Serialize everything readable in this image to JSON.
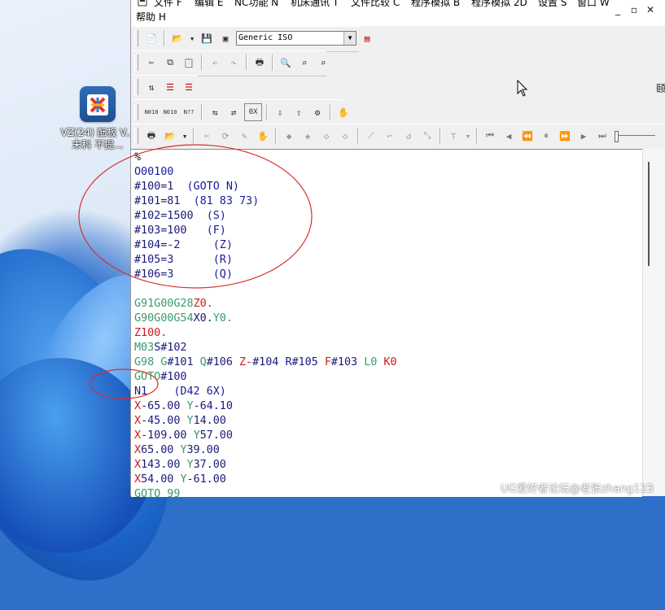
{
  "desktop": {
    "icon_label_line1": "VZ(24) 酝板 V...",
    "icon_label_line2": "末科 不提..."
  },
  "menubar": {
    "items": [
      "文件 F",
      "编辑 E",
      "NC功能 N",
      "机床通讯 T",
      "文件比较 C",
      "程序模拟 B",
      "程序模拟 2D",
      "设置 S",
      "窗口 W"
    ],
    "help": "帮助 H"
  },
  "toolbar": {
    "controller_select": "Generic ISO"
  },
  "side_glyph": "颐",
  "editor": {
    "lines": [
      [
        {
          "t": "%",
          "c": "c-dark"
        }
      ],
      [
        {
          "t": "O00100",
          "c": "c-blue"
        }
      ],
      [
        {
          "t": "#100=1  ",
          "c": "c-addr"
        },
        {
          "t": "(GOTO N)",
          "c": "c-blue"
        }
      ],
      [
        {
          "t": "#101=81  ",
          "c": "c-addr"
        },
        {
          "t": "(81 83 73)",
          "c": "c-blue"
        }
      ],
      [
        {
          "t": "#102=1500  ",
          "c": "c-addr"
        },
        {
          "t": "(S)",
          "c": "c-blue"
        }
      ],
      [
        {
          "t": "#103=100   ",
          "c": "c-addr"
        },
        {
          "t": "(F)",
          "c": "c-blue"
        }
      ],
      [
        {
          "t": "#104=-2     ",
          "c": "c-addr"
        },
        {
          "t": "(Z)",
          "c": "c-blue"
        }
      ],
      [
        {
          "t": "#105=3      ",
          "c": "c-addr"
        },
        {
          "t": "(R)",
          "c": "c-blue"
        }
      ],
      [
        {
          "t": "#106=3      ",
          "c": "c-addr"
        },
        {
          "t": "(Q)",
          "c": "c-blue"
        }
      ],
      [
        {
          "t": "",
          "c": "c-dark"
        }
      ],
      [
        {
          "t": "G91G00G28",
          "c": "c-green"
        },
        {
          "t": "Z0.",
          "c": "c-red"
        }
      ],
      [
        {
          "t": "G90G00G54",
          "c": "c-green"
        },
        {
          "t": "X0.",
          "c": "c-addr"
        },
        {
          "t": "Y0.",
          "c": "c-green"
        }
      ],
      [
        {
          "t": "Z100.",
          "c": "c-red"
        }
      ],
      [
        {
          "t": "M03",
          "c": "c-green"
        },
        {
          "t": "S#102",
          "c": "c-addr"
        }
      ],
      [
        {
          "t": "G98 ",
          "c": "c-green"
        },
        {
          "t": "G",
          "c": "c-green"
        },
        {
          "t": "#101 ",
          "c": "c-addr"
        },
        {
          "t": "Q",
          "c": "c-green"
        },
        {
          "t": "#106 ",
          "c": "c-addr"
        },
        {
          "t": "Z-",
          "c": "c-red"
        },
        {
          "t": "#104 ",
          "c": "c-addr"
        },
        {
          "t": "R",
          "c": "c-blue"
        },
        {
          "t": "#105 ",
          "c": "c-addr"
        },
        {
          "t": "F",
          "c": "c-red"
        },
        {
          "t": "#103 ",
          "c": "c-addr"
        },
        {
          "t": "L0 ",
          "c": "c-green"
        },
        {
          "t": "K0",
          "c": "c-red"
        }
      ],
      [
        {
          "t": "GOTO",
          "c": "c-green"
        },
        {
          "t": "#100",
          "c": "c-addr"
        }
      ],
      [
        {
          "t": "N1",
          "c": "c-addr"
        },
        {
          "t": "    (D42 6X)",
          "c": "c-blue"
        }
      ],
      [
        {
          "t": "X",
          "c": "c-red"
        },
        {
          "t": "-65.00 ",
          "c": "c-addr"
        },
        {
          "t": "Y",
          "c": "c-green"
        },
        {
          "t": "-64.10",
          "c": "c-addr"
        }
      ],
      [
        {
          "t": "X",
          "c": "c-red"
        },
        {
          "t": "-45.00 ",
          "c": "c-addr"
        },
        {
          "t": "Y",
          "c": "c-green"
        },
        {
          "t": "14.00",
          "c": "c-addr"
        }
      ],
      [
        {
          "t": "X",
          "c": "c-red"
        },
        {
          "t": "-109.00 ",
          "c": "c-addr"
        },
        {
          "t": "Y",
          "c": "c-green"
        },
        {
          "t": "57.00",
          "c": "c-addr"
        }
      ],
      [
        {
          "t": "X",
          "c": "c-red"
        },
        {
          "t": "65.00 ",
          "c": "c-addr"
        },
        {
          "t": "Y",
          "c": "c-green"
        },
        {
          "t": "39.00",
          "c": "c-addr"
        }
      ],
      [
        {
          "t": "X",
          "c": "c-red"
        },
        {
          "t": "143.00 ",
          "c": "c-addr"
        },
        {
          "t": "Y",
          "c": "c-green"
        },
        {
          "t": "37.00",
          "c": "c-addr"
        }
      ],
      [
        {
          "t": "X",
          "c": "c-red"
        },
        {
          "t": "54.00 ",
          "c": "c-addr"
        },
        {
          "t": "Y",
          "c": "c-green"
        },
        {
          "t": "-61.00",
          "c": "c-addr"
        }
      ],
      [
        {
          "t": "GOTO 99",
          "c": "c-green"
        }
      ]
    ]
  },
  "watermark": "UG爱好者论坛@老张zhang123"
}
